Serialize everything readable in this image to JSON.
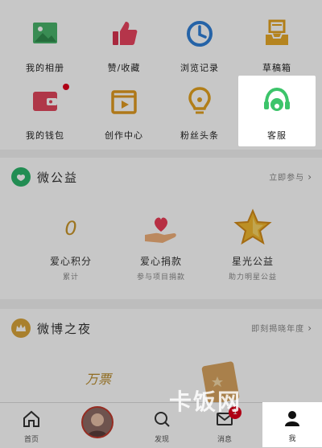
{
  "grid": {
    "items": [
      {
        "label": "我的相册"
      },
      {
        "label": "赞/收藏"
      },
      {
        "label": "浏览记录"
      },
      {
        "label": "草稿箱"
      },
      {
        "label": "我的钱包"
      },
      {
        "label": "创作中心"
      },
      {
        "label": "粉丝头条"
      },
      {
        "label": "客服"
      }
    ]
  },
  "charity": {
    "title": "微公益",
    "link": "立即参与",
    "items": [
      {
        "value": "0",
        "title": "爱心积分",
        "subtitle": "累计"
      },
      {
        "title": "爱心捐款",
        "subtitle": "参与项目捐款"
      },
      {
        "title": "星光公益",
        "subtitle": "助力明星公益"
      }
    ]
  },
  "night": {
    "title": "微博之夜",
    "link": "即刻揭晓年度",
    "ticket": "万票"
  },
  "nav": {
    "items": [
      {
        "label": "首页"
      },
      {
        "label": "发现"
      },
      {
        "label": "消息"
      },
      {
        "label": "我"
      }
    ],
    "message_badge": "1"
  },
  "watermark": "卡饭网"
}
